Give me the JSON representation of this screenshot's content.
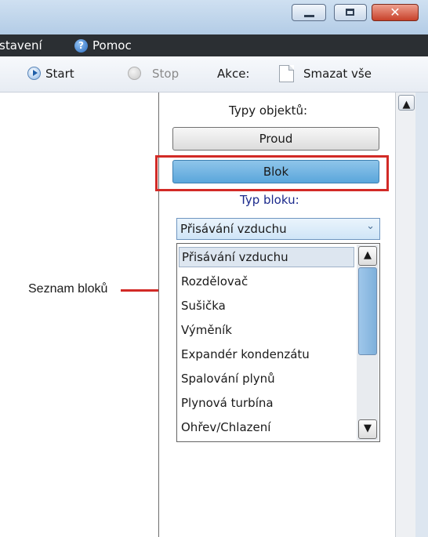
{
  "window": {
    "close_glyph": "✕"
  },
  "menubar": {
    "item_settings": "stavení",
    "item_help": "Pomoc",
    "help_icon_glyph": "?"
  },
  "toolbar": {
    "start_label": "Start",
    "stop_label": "Stop",
    "actions_label": "Akce:",
    "clear_all_label": "Smazat vše"
  },
  "panel": {
    "object_types_label": "Typy objektů:",
    "button_stream": "Proud",
    "button_block": "Blok",
    "block_type_label": "Typ bloku:",
    "block_type_selected": "Přisávání vzduchu",
    "block_list": [
      "Přisávání vzduchu",
      "Rozdělovač",
      "Sušička",
      "Výměník",
      "Expandér kondenzátu",
      "Spalování plynů",
      "Plynová turbína",
      "Ohřev/Chlazení"
    ]
  },
  "annotation": {
    "label": "Seznam bloků"
  },
  "colors": {
    "highlight": "#d22a26",
    "selected_button": "#5aa6db",
    "menubar": "#2b2f33"
  }
}
